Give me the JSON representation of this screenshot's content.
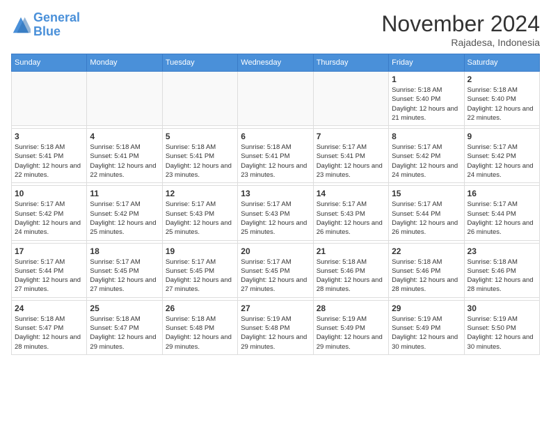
{
  "logo": {
    "name1": "General",
    "name2": "Blue"
  },
  "title": "November 2024",
  "location": "Rajadesa, Indonesia",
  "days_of_week": [
    "Sunday",
    "Monday",
    "Tuesday",
    "Wednesday",
    "Thursday",
    "Friday",
    "Saturday"
  ],
  "weeks": [
    [
      {
        "day": "",
        "info": ""
      },
      {
        "day": "",
        "info": ""
      },
      {
        "day": "",
        "info": ""
      },
      {
        "day": "",
        "info": ""
      },
      {
        "day": "",
        "info": ""
      },
      {
        "day": "1",
        "info": "Sunrise: 5:18 AM\nSunset: 5:40 PM\nDaylight: 12 hours and 21 minutes."
      },
      {
        "day": "2",
        "info": "Sunrise: 5:18 AM\nSunset: 5:40 PM\nDaylight: 12 hours and 22 minutes."
      }
    ],
    [
      {
        "day": "3",
        "info": "Sunrise: 5:18 AM\nSunset: 5:41 PM\nDaylight: 12 hours and 22 minutes."
      },
      {
        "day": "4",
        "info": "Sunrise: 5:18 AM\nSunset: 5:41 PM\nDaylight: 12 hours and 22 minutes."
      },
      {
        "day": "5",
        "info": "Sunrise: 5:18 AM\nSunset: 5:41 PM\nDaylight: 12 hours and 23 minutes."
      },
      {
        "day": "6",
        "info": "Sunrise: 5:18 AM\nSunset: 5:41 PM\nDaylight: 12 hours and 23 minutes."
      },
      {
        "day": "7",
        "info": "Sunrise: 5:17 AM\nSunset: 5:41 PM\nDaylight: 12 hours and 23 minutes."
      },
      {
        "day": "8",
        "info": "Sunrise: 5:17 AM\nSunset: 5:42 PM\nDaylight: 12 hours and 24 minutes."
      },
      {
        "day": "9",
        "info": "Sunrise: 5:17 AM\nSunset: 5:42 PM\nDaylight: 12 hours and 24 minutes."
      }
    ],
    [
      {
        "day": "10",
        "info": "Sunrise: 5:17 AM\nSunset: 5:42 PM\nDaylight: 12 hours and 24 minutes."
      },
      {
        "day": "11",
        "info": "Sunrise: 5:17 AM\nSunset: 5:42 PM\nDaylight: 12 hours and 25 minutes."
      },
      {
        "day": "12",
        "info": "Sunrise: 5:17 AM\nSunset: 5:43 PM\nDaylight: 12 hours and 25 minutes."
      },
      {
        "day": "13",
        "info": "Sunrise: 5:17 AM\nSunset: 5:43 PM\nDaylight: 12 hours and 25 minutes."
      },
      {
        "day": "14",
        "info": "Sunrise: 5:17 AM\nSunset: 5:43 PM\nDaylight: 12 hours and 26 minutes."
      },
      {
        "day": "15",
        "info": "Sunrise: 5:17 AM\nSunset: 5:44 PM\nDaylight: 12 hours and 26 minutes."
      },
      {
        "day": "16",
        "info": "Sunrise: 5:17 AM\nSunset: 5:44 PM\nDaylight: 12 hours and 26 minutes."
      }
    ],
    [
      {
        "day": "17",
        "info": "Sunrise: 5:17 AM\nSunset: 5:44 PM\nDaylight: 12 hours and 27 minutes."
      },
      {
        "day": "18",
        "info": "Sunrise: 5:17 AM\nSunset: 5:45 PM\nDaylight: 12 hours and 27 minutes."
      },
      {
        "day": "19",
        "info": "Sunrise: 5:17 AM\nSunset: 5:45 PM\nDaylight: 12 hours and 27 minutes."
      },
      {
        "day": "20",
        "info": "Sunrise: 5:17 AM\nSunset: 5:45 PM\nDaylight: 12 hours and 27 minutes."
      },
      {
        "day": "21",
        "info": "Sunrise: 5:18 AM\nSunset: 5:46 PM\nDaylight: 12 hours and 28 minutes."
      },
      {
        "day": "22",
        "info": "Sunrise: 5:18 AM\nSunset: 5:46 PM\nDaylight: 12 hours and 28 minutes."
      },
      {
        "day": "23",
        "info": "Sunrise: 5:18 AM\nSunset: 5:46 PM\nDaylight: 12 hours and 28 minutes."
      }
    ],
    [
      {
        "day": "24",
        "info": "Sunrise: 5:18 AM\nSunset: 5:47 PM\nDaylight: 12 hours and 28 minutes."
      },
      {
        "day": "25",
        "info": "Sunrise: 5:18 AM\nSunset: 5:47 PM\nDaylight: 12 hours and 29 minutes."
      },
      {
        "day": "26",
        "info": "Sunrise: 5:18 AM\nSunset: 5:48 PM\nDaylight: 12 hours and 29 minutes."
      },
      {
        "day": "27",
        "info": "Sunrise: 5:19 AM\nSunset: 5:48 PM\nDaylight: 12 hours and 29 minutes."
      },
      {
        "day": "28",
        "info": "Sunrise: 5:19 AM\nSunset: 5:49 PM\nDaylight: 12 hours and 29 minutes."
      },
      {
        "day": "29",
        "info": "Sunrise: 5:19 AM\nSunset: 5:49 PM\nDaylight: 12 hours and 30 minutes."
      },
      {
        "day": "30",
        "info": "Sunrise: 5:19 AM\nSunset: 5:50 PM\nDaylight: 12 hours and 30 minutes."
      }
    ]
  ]
}
